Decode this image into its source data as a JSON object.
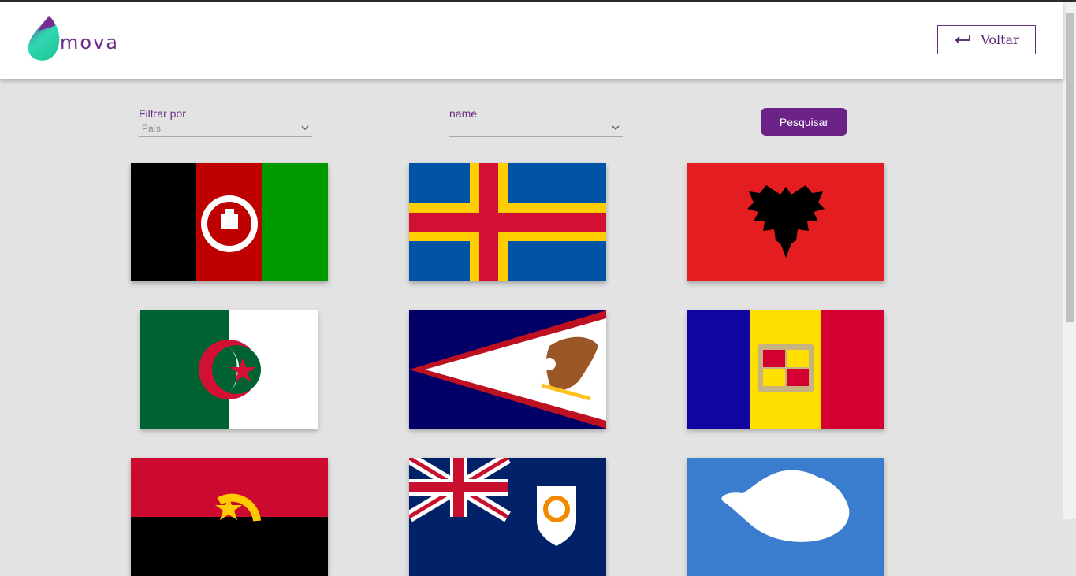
{
  "header": {
    "logo_text": "mova",
    "back_button_label": "Voltar"
  },
  "filters": {
    "filter_by": {
      "label": "Filtrar por",
      "value": "País"
    },
    "field": {
      "label": "name",
      "value": ""
    },
    "search_button_label": "Pesquisar"
  },
  "flags": [
    {
      "country": "Afghanistan",
      "icon": "flag-afghanistan"
    },
    {
      "country": "Åland Islands",
      "icon": "flag-aland"
    },
    {
      "country": "Albania",
      "icon": "flag-albania"
    },
    {
      "country": "Algeria",
      "icon": "flag-algeria"
    },
    {
      "country": "American Samoa",
      "icon": "flag-american-samoa"
    },
    {
      "country": "Andorra",
      "icon": "flag-andorra"
    },
    {
      "country": "Angola",
      "icon": "flag-angola"
    },
    {
      "country": "Anguilla",
      "icon": "flag-anguilla"
    },
    {
      "country": "Antarctica",
      "icon": "flag-antarctica"
    }
  ],
  "colors": {
    "accent": "#6b2388",
    "background": "#e3e3e3",
    "logo_gradient": [
      "#7b2a93",
      "#2fd7b1"
    ]
  }
}
